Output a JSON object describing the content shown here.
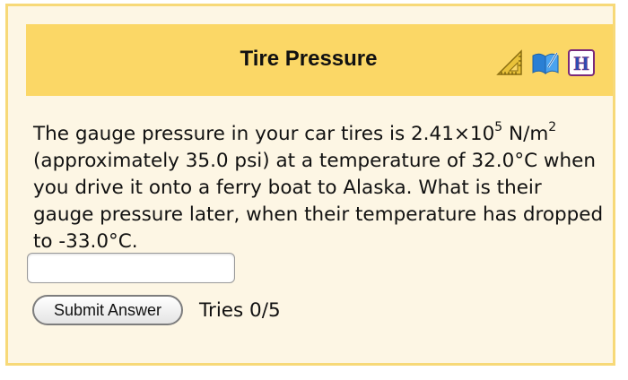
{
  "header": {
    "title": "Tire Pressure",
    "icons": [
      "ruler-triangle-icon",
      "book-icon",
      "hint-icon"
    ],
    "hint_letter": "H"
  },
  "question": {
    "text_part1": "The gauge pressure in your car tires is 2.41×10",
    "exponent1": "5",
    "text_part2": " N/m",
    "exponent2": "2",
    "text_part3": " (approximately 35.0 psi) at a temperature of 32.0°C when you drive it onto a ferry boat to Alaska. What is their gauge pressure later, when their temperature has dropped to -33.0°C."
  },
  "answer": {
    "value": "",
    "placeholder": ""
  },
  "submit": {
    "label": "Submit Answer"
  },
  "tries": {
    "text": "Tries 0/5"
  },
  "colors": {
    "header_bg": "#fbd766",
    "panel_bg": "#fdf6e4",
    "border": "#f7d978"
  }
}
